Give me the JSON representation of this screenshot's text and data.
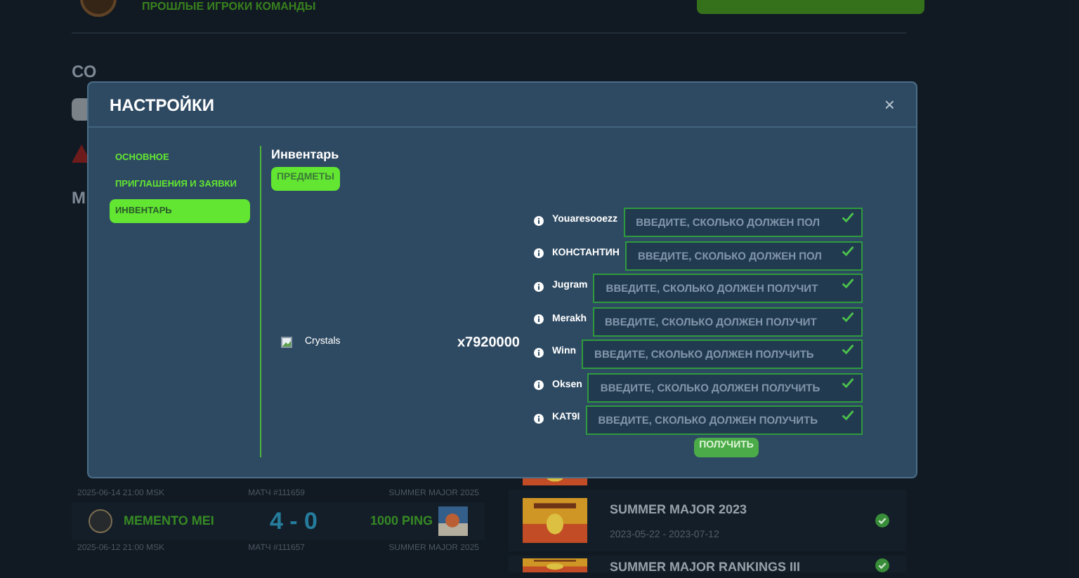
{
  "background": {
    "team_subtitle": "ПРОШЛЫЕ ИГРОКИ КОМАНДЫ",
    "section_heading_1": "СО",
    "section_heading_2": "М",
    "matches": [
      {
        "date": "2025-06-14 21:00 MSK",
        "match": "МАТЧ #111659",
        "event": "SUMMER MAJOR 2025",
        "team_1": "MEMENTO MEI",
        "score": "4 - 0",
        "team_2": "1000 PING"
      },
      {
        "date": "2025-06-12 21:00 MSK",
        "match": "МАТЧ #111657",
        "event": "SUMMER MAJOR 2025"
      }
    ],
    "tournaments": [
      {
        "title": "SUMMER MAJOR 2023",
        "dates": "2023-05-22 - 2023-07-12",
        "completed": true
      },
      {
        "title": "SUMMER MAJOR RANKINGS III",
        "completed": true
      }
    ]
  },
  "modal": {
    "title": "НАСТРОЙКИ",
    "close": "×",
    "nav": [
      {
        "label": "ОСНОВНОЕ",
        "selected": false
      },
      {
        "label": "ПРИГЛАШЕНИЯ И ЗАЯВКИ",
        "selected": false
      },
      {
        "label": "ИНВЕНТАРЬ",
        "selected": true
      }
    ],
    "section_title": "Инвентарь",
    "tabs": [
      {
        "label": "ПРЕДМЕТЫ",
        "selected": true
      }
    ],
    "item": {
      "name": "Crystals",
      "quantity": "x7920000"
    },
    "players": [
      {
        "name": "Youaresooezz",
        "placeholder": "ВВЕДИТЕ, СКОЛЬКО ДОЛЖЕН ПОЛ"
      },
      {
        "name": "КОНСТАНТИН",
        "placeholder": "ВВЕДИТЕ, СКОЛЬКО ДОЛЖЕН ПОЛ"
      },
      {
        "name": "Jugram",
        "placeholder": "ВВЕДИТЕ, СКОЛЬКО ДОЛЖЕН ПОЛУЧИТ"
      },
      {
        "name": "Merakh",
        "placeholder": "ВВЕДИТЕ, СКОЛЬКО ДОЛЖЕН ПОЛУЧИТ"
      },
      {
        "name": "Winn",
        "placeholder": "ВВЕДИТЕ, СКОЛЬКО ДОЛЖЕН ПОЛУЧИТЬ"
      },
      {
        "name": "Oksen",
        "placeholder": "ВВЕДИТЕ, СКОЛЬКО ДОЛЖЕН ПОЛУЧИТЬ"
      },
      {
        "name": "KAT9I",
        "placeholder": "ВВЕДИТЕ, СКОЛЬКО ДОЛЖЕН ПОЛУЧИТЬ"
      }
    ],
    "submit": "ПОЛУЧИТЬ"
  }
}
